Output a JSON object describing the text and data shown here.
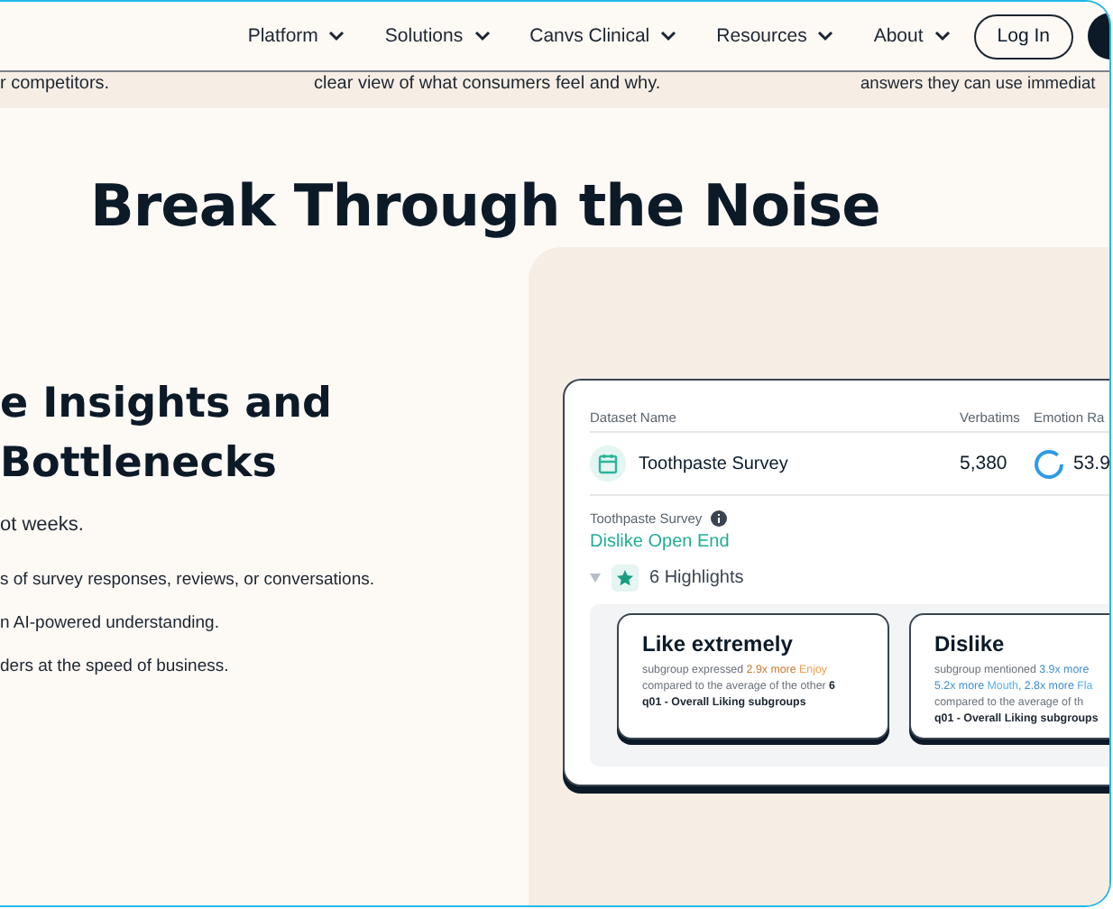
{
  "nav": {
    "items": [
      {
        "label": "Platform"
      },
      {
        "label": "Solutions"
      },
      {
        "label": "Canvs Clinical"
      },
      {
        "label": "Resources"
      },
      {
        "label": "About"
      }
    ],
    "login": "Log In"
  },
  "strip": [
    "r competitors.",
    "clear view of what consumers feel and why.",
    "answers they can use immediat"
  ],
  "headline": "Break Through the Noise",
  "left": {
    "heading": [
      "e Insights and",
      "Bottlenecks"
    ],
    "intro": "ot weeks.",
    "points": [
      "s of survey responses, reviews, or conversations.",
      "n AI-powered understanding.",
      "ders at the speed of business."
    ]
  },
  "card": {
    "columns": [
      "Dataset Name",
      "Verbatims",
      "Emotion Ra"
    ],
    "dataset": {
      "name": "Toothpaste Survey",
      "verbatims": "5,380",
      "rate": "53.9"
    },
    "breadcrumb": "Toothpaste Survey",
    "question": "Dislike Open End",
    "highlights": {
      "label": "6 Highlights",
      "expanded": true
    },
    "insights": [
      {
        "title": "Like extremely",
        "lines": [
          [
            {
              "text": "subgroup expressed ",
              "color": "#6a727b"
            },
            {
              "text": "2.9x more ",
              "color": "#c87a2f"
            },
            {
              "text": "Enjoy",
              "color": "#f0a04b"
            }
          ],
          [
            {
              "text": "compared to the average of the other ",
              "color": "#6a727b"
            },
            {
              "text": "6",
              "color": "#1c2530",
              "strong": true
            }
          ],
          [
            {
              "text": "q01 - Overall Liking subgroups",
              "color": "#1c2530",
              "strong": true
            }
          ]
        ]
      },
      {
        "title": "Dislike",
        "lines": [
          [
            {
              "text": "subgroup mentioned ",
              "color": "#6a727b"
            },
            {
              "text": "3.9x more",
              "color": "#3d8fcf"
            }
          ],
          [
            {
              "text": "5.2x more ",
              "color": "#3d8fcf"
            },
            {
              "text": "Mouth",
              "color": "#5ab0ef"
            },
            {
              "text": ", 2.8x more ",
              "color": "#3d8fcf"
            },
            {
              "text": "Fla",
              "color": "#5ab0ef"
            }
          ],
          [
            {
              "text": "compared to the average of th",
              "color": "#6a727b"
            }
          ],
          [
            {
              "text": "q01 - Overall Liking subgroups",
              "color": "#1c2530",
              "strong": true
            }
          ]
        ]
      }
    ]
  }
}
